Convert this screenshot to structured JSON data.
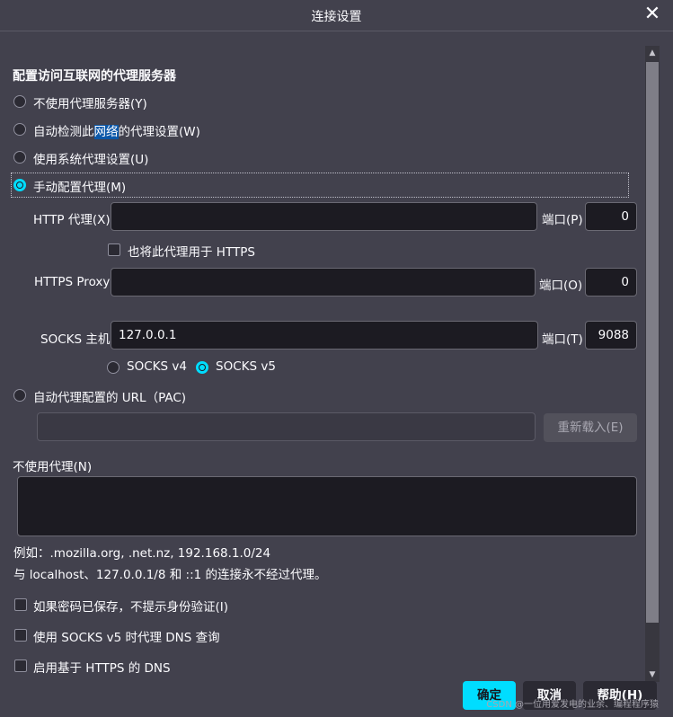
{
  "dialog": {
    "title": "连接设置",
    "close_icon": "close-icon"
  },
  "section_heading": "配置访问互联网的代理服务器",
  "proxy_modes": {
    "none": "不使用代理服务器(Y)",
    "auto_detect_prefix": "自动检测此",
    "auto_detect_highlight": "网络",
    "auto_detect_suffix": "的代理设置(W)",
    "system": "使用系统代理设置(U)",
    "manual": "手动配置代理(M)"
  },
  "manual": {
    "http_label": "HTTP 代理(X)",
    "http_value": "",
    "http_port_label": "端口(P)",
    "http_port": "0",
    "also_https_label": "也将此代理用于 HTTPS",
    "https_label": "HTTPS Proxy",
    "https_value": "",
    "https_port_label": "端口(O)",
    "https_port": "0",
    "socks_label": "SOCKS 主机",
    "socks_value": "127.0.0.1",
    "socks_port_label": "端口(T)",
    "socks_port": "9088",
    "socks_v4": "SOCKS v4",
    "socks_v5": "SOCKS v5",
    "socks_version": "v5"
  },
  "pac": {
    "label": "自动代理配置的 URL（PAC)",
    "value": "",
    "reload_label": "重新载入(E)"
  },
  "no_proxy": {
    "label": "不使用代理(N)",
    "value": "",
    "example": "例如：.mozilla.org, .net.nz, 192.168.1.0/24",
    "note": "与 localhost、127.0.0.1/8 和 ::1 的连接永不经过代理。"
  },
  "options": {
    "no_auth_prompt": "如果密码已保存，不提示身份验证(I)",
    "socks_dns": "使用 SOCKS v5 时代理 DNS 查询",
    "https_dns": "启用基于 HTTPS 的 DNS"
  },
  "buttons": {
    "ok": "确定",
    "cancel": "取消",
    "help": "帮助(H)"
  },
  "watermark": "CSDN @一位用爱发电的业余、编程程序猿",
  "colors": {
    "accent": "#00ddff",
    "background": "#42414d",
    "input": "#1c1b22"
  }
}
